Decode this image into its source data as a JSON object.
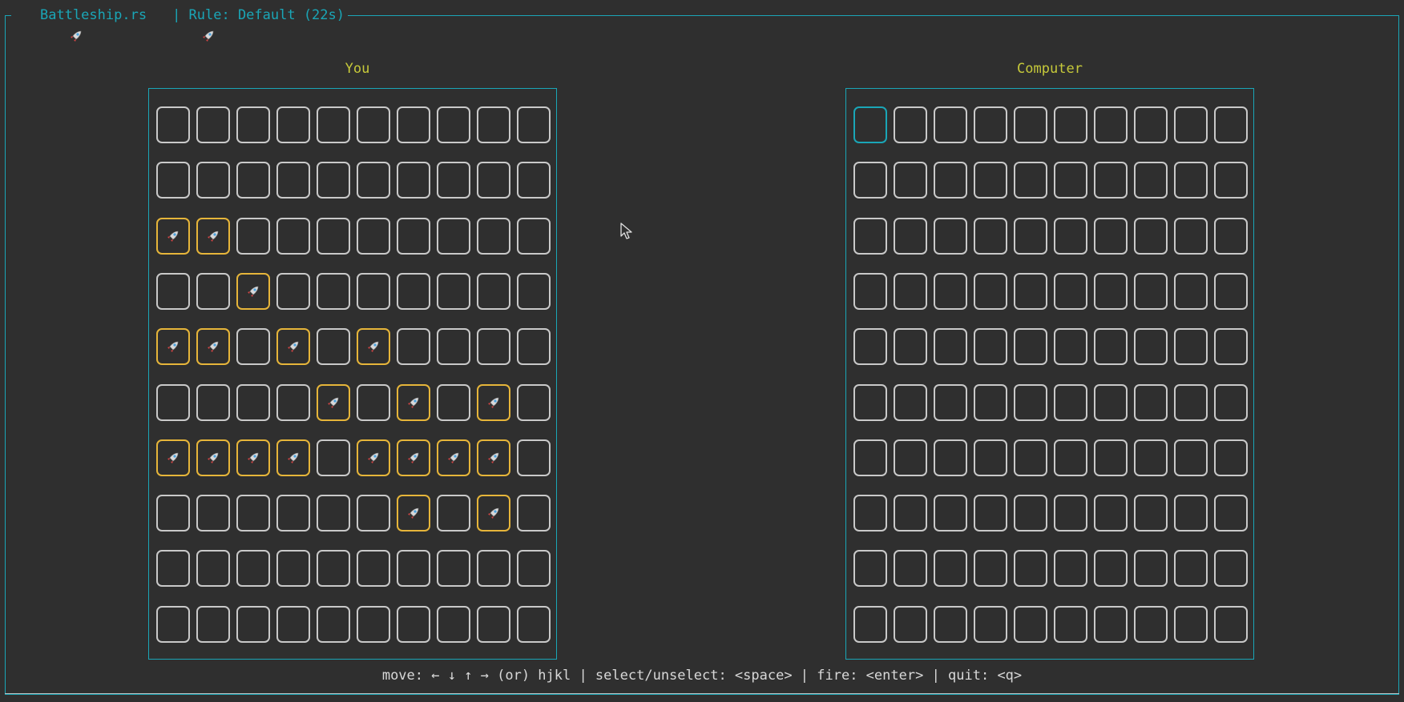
{
  "window": {
    "app_title": "Battleship.rs",
    "rule_text": "| Rule: Default (22s)",
    "title_icon": "rocket-icon",
    "accent_color": "#1aa6b7"
  },
  "boards": [
    {
      "label": "You",
      "ship_rows": [
        [
          0,
          0,
          0,
          0,
          0,
          0,
          0,
          0,
          0,
          0
        ],
        [
          0,
          0,
          0,
          0,
          0,
          0,
          0,
          0,
          0,
          0
        ],
        [
          1,
          1,
          0,
          0,
          0,
          0,
          0,
          0,
          0,
          0
        ],
        [
          0,
          0,
          1,
          0,
          0,
          0,
          0,
          0,
          0,
          0
        ],
        [
          1,
          1,
          0,
          1,
          0,
          1,
          0,
          0,
          0,
          0
        ],
        [
          0,
          0,
          0,
          0,
          1,
          0,
          1,
          0,
          1,
          0
        ],
        [
          1,
          1,
          1,
          1,
          0,
          1,
          1,
          1,
          1,
          0
        ],
        [
          0,
          0,
          0,
          0,
          0,
          0,
          1,
          0,
          1,
          0
        ],
        [
          0,
          0,
          0,
          0,
          0,
          0,
          0,
          0,
          0,
          0
        ],
        [
          0,
          0,
          0,
          0,
          0,
          0,
          0,
          0,
          0,
          0
        ]
      ]
    },
    {
      "label": "Computer",
      "cursor": [
        0,
        0
      ]
    }
  ],
  "help": {
    "text": "move: ← ↓ ↑ → (or) hjkl | select/unselect: <space> | fire: <enter> | quit: <q>"
  },
  "colors": {
    "ship_border": "#e6b53a",
    "cell_border": "#c9c9c9",
    "cursor_border": "#1aa6b7",
    "label": "#c6c93a"
  }
}
